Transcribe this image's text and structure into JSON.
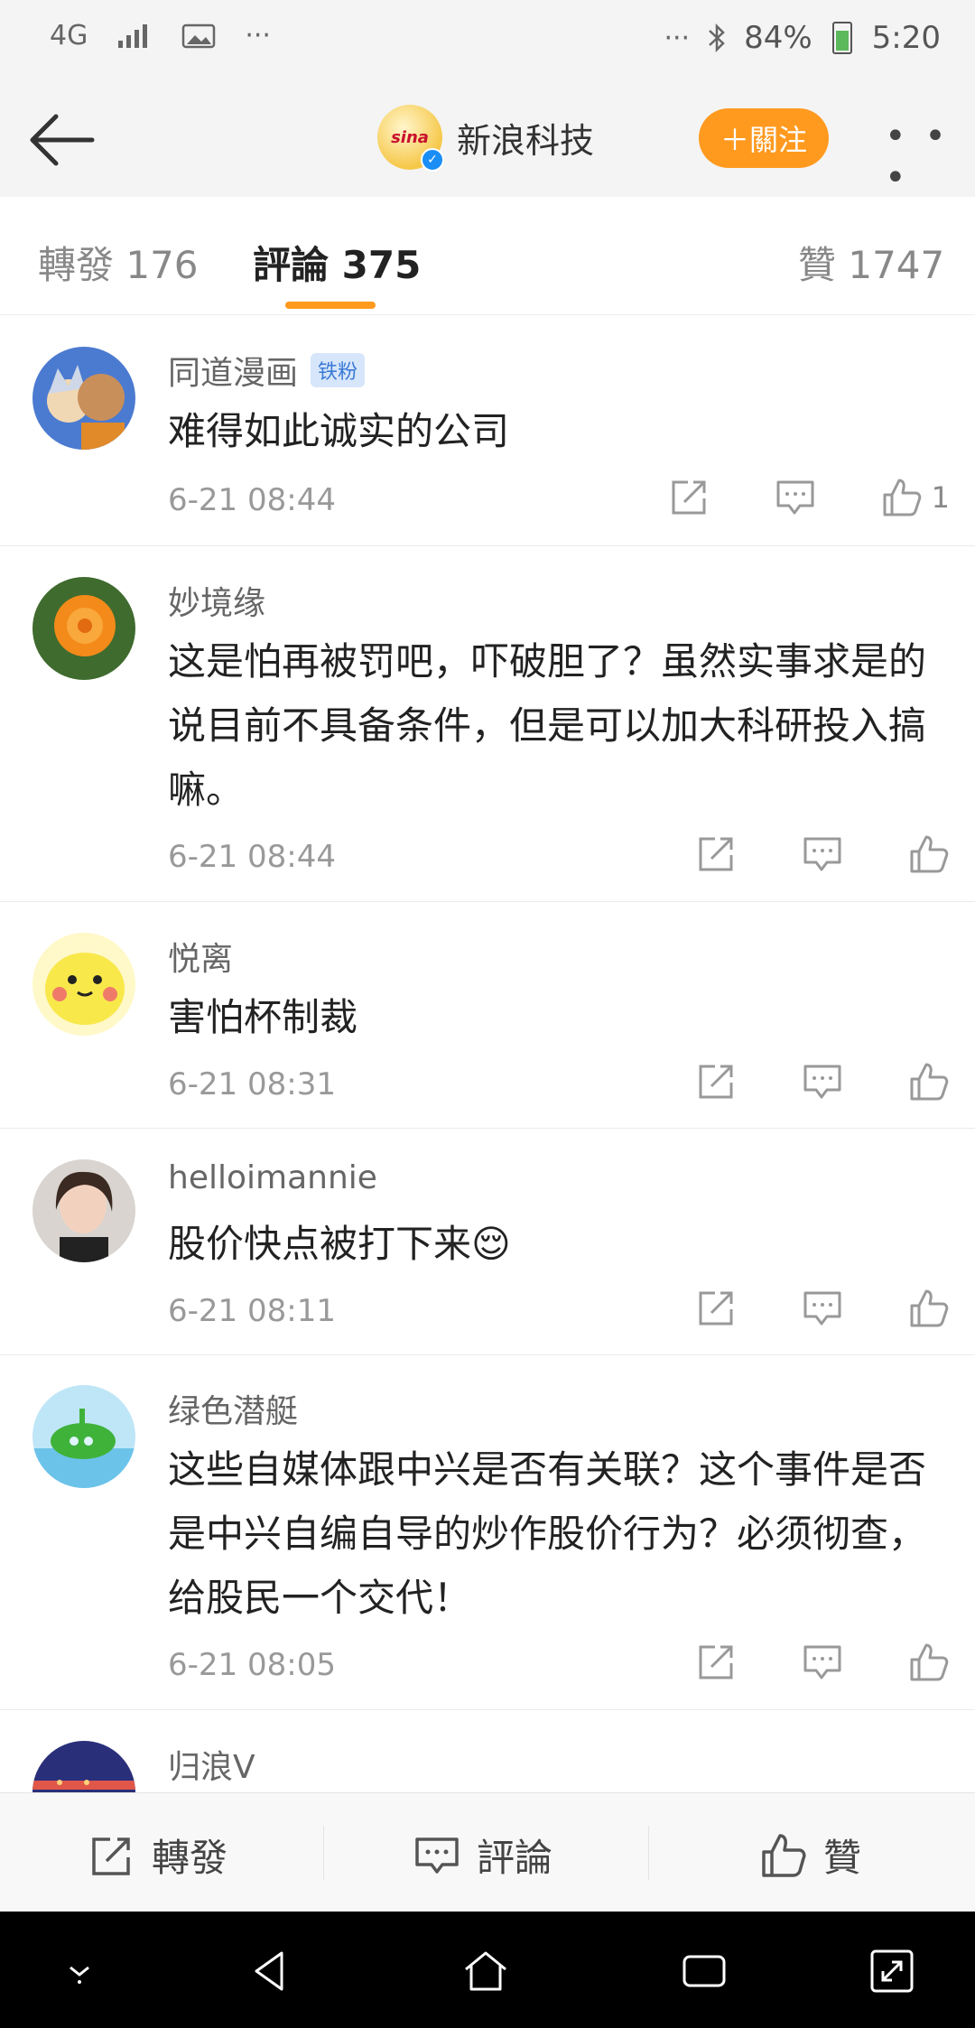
{
  "status_bar": {
    "left": [
      "4G",
      "signal",
      "image",
      "···"
    ],
    "network": "4G",
    "dots": "···",
    "right_dots": "···",
    "battery": "84%",
    "time": "5:20"
  },
  "header": {
    "title": "新浪科技",
    "logo_text": "sina",
    "follow_label": "＋關注",
    "more": "• • •"
  },
  "tabs": [
    {
      "label": "轉發 176"
    },
    {
      "label": "評論 375"
    },
    {
      "label": "贊 1747"
    }
  ],
  "comments": [
    {
      "name": "同道漫画",
      "badge": "铁粉",
      "text": "难得如此诚实的公司",
      "time": "6-21 08:44",
      "likes": "1"
    },
    {
      "name": "妙境缘",
      "badge": "",
      "text": "这是怕再被罚吧，吓破胆了？虽然实事求是的说目前不具备条件，但是可以加大科研投入搞嘛。",
      "time": "6-21 08:44",
      "likes": ""
    },
    {
      "name": "悦离",
      "badge": "",
      "text": "害怕杯制裁",
      "time": "6-21 08:31",
      "likes": ""
    },
    {
      "name": "helloimannie",
      "badge": "",
      "text": "股价快点被打下来😌",
      "time": "6-21 08:11",
      "likes": ""
    },
    {
      "name": "绿色潜艇",
      "badge": "",
      "text": "这些自媒体跟中兴是否有关联？这个事件是否是中兴自编自导的炒作股价行为？必须彻查，给股民一个交代！",
      "time": "6-21 08:05",
      "likes": ""
    },
    {
      "name": "归浪V",
      "badge": "",
      "text": "",
      "time": "",
      "likes": ""
    }
  ],
  "bottom_bar": {
    "repost": "轉發",
    "comment": "評論",
    "like": "贊"
  },
  "colors": {
    "accent": "#ff9a1f",
    "bg_header": "#f4f4f4"
  }
}
